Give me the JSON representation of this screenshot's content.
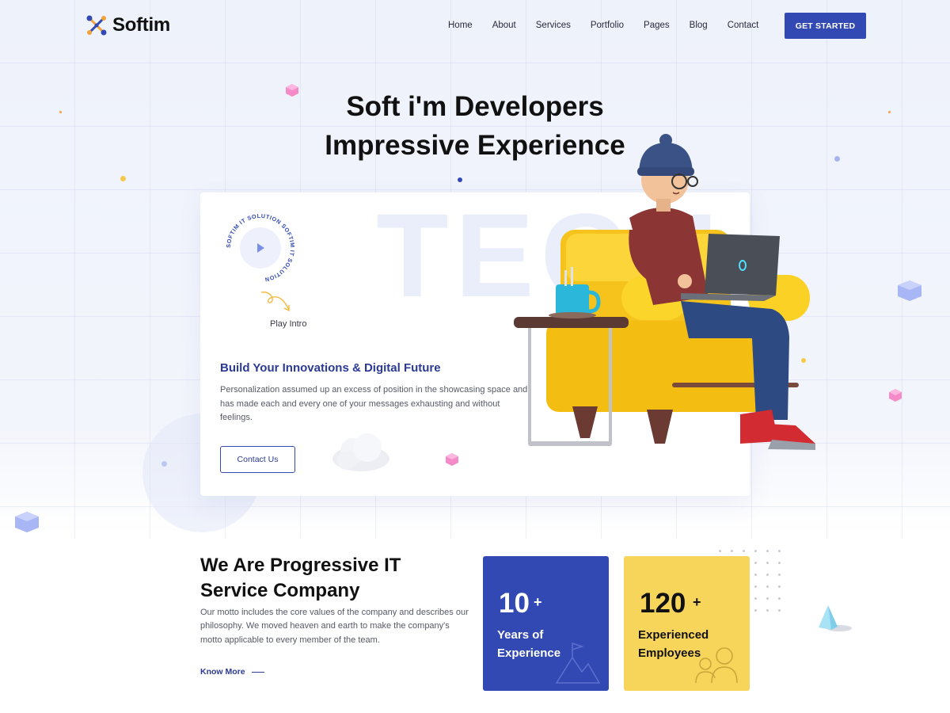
{
  "brand": {
    "name": "Softim",
    "logo_icon": "molecule-logo-icon"
  },
  "nav": {
    "items": [
      "Home",
      "About",
      "Services",
      "Portfolio",
      "Pages",
      "Blog",
      "Contact"
    ],
    "cta_label": "GET STARTED"
  },
  "hero": {
    "title_line1": "Soft i'm Developers",
    "title_line2": "Impressive Experience"
  },
  "card": {
    "background_word": "TECH",
    "circle_text": "SOFTIM IT SOLUTION SOFTIM IT SOLUTION",
    "play_label": "Play Intro",
    "heading": "Build Your Innovations & Digital Future",
    "text": "Personalization assumed up an excess of position in the showcasing space and has made each and every one of your messages exhausting and without feelings.",
    "button_label": "Contact Us"
  },
  "about": {
    "title": "We Are Progressive IT Service Company",
    "text": "Our motto includes the core values of the company and describes our philosophy. We moved heaven and earth to make the company's motto applicable to every member of the team.",
    "link_label": "Know More"
  },
  "stats": [
    {
      "number": "10",
      "suffix": "+",
      "label": "Years of Experience",
      "icon": "mountain-flag-icon",
      "color": "#3249b4"
    },
    {
      "number": "120",
      "suffix": "+",
      "label": "Experienced Employees",
      "icon": "team-people-icon",
      "color": "#f7d45a"
    }
  ],
  "colors": {
    "primary": "#3249b4",
    "accent_yellow": "#f7d45a",
    "heading_blue": "#2b3a93"
  }
}
